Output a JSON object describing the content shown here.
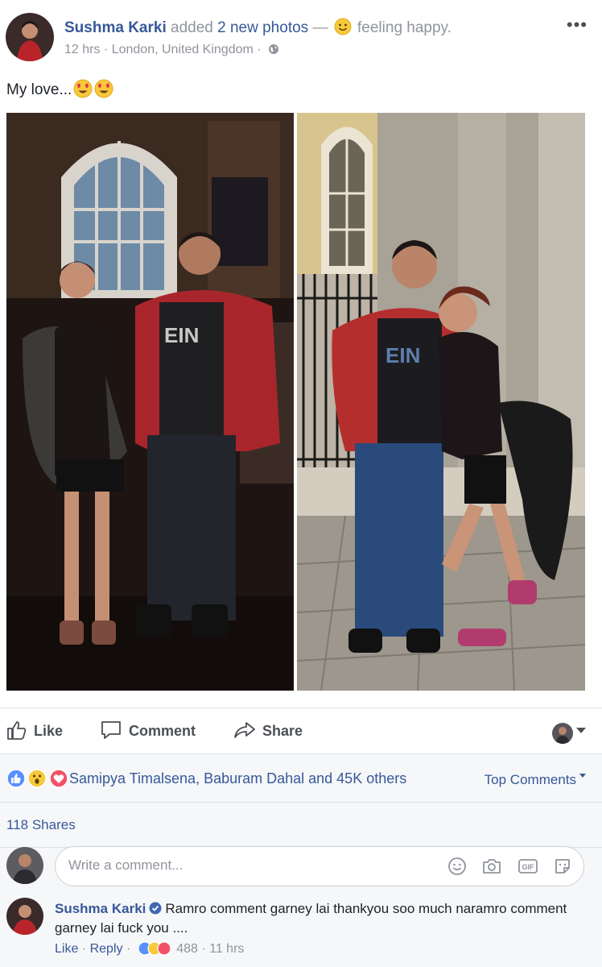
{
  "post": {
    "author": "Sushma Karki",
    "action_text": "added",
    "photos_link": "2 new photos",
    "separator": "—",
    "feeling": "feeling happy.",
    "time": "12 hrs",
    "dot": "·",
    "location": "London, United Kingdom",
    "meta_dot": "·",
    "more": "•••",
    "caption": "My love..."
  },
  "actions": {
    "like": "Like",
    "comment": "Comment",
    "share": "Share"
  },
  "reactions": {
    "names": "Samipya Timalsena, Baburam Dahal and 45K others",
    "sort": "Top Comments"
  },
  "shares": "118 Shares",
  "composer": {
    "placeholder": "Write a comment..."
  },
  "comment": {
    "author": "Sushma Karki",
    "text": "Ramro comment garney lai thankyou soo much naramro comment garney lai fuck you ....",
    "like": "Like",
    "reply": "Reply",
    "sep": "·",
    "count": "488",
    "time": "11 hrs"
  },
  "colors": {
    "link_blue": "#365899",
    "muted_gray": "#90949c",
    "panel_bg": "#f6f7f9"
  },
  "icons": [
    "globe-icon",
    "more-icon",
    "smile-emoji-icon",
    "heart-eyes-emoji-icon",
    "like-thumb-icon",
    "comment-bubble-icon",
    "share-arrow-icon",
    "like-reaction-icon",
    "wow-reaction-icon",
    "love-reaction-icon",
    "emoji-icon",
    "camera-icon",
    "gif-icon",
    "sticker-icon",
    "verified-badge-icon"
  ]
}
